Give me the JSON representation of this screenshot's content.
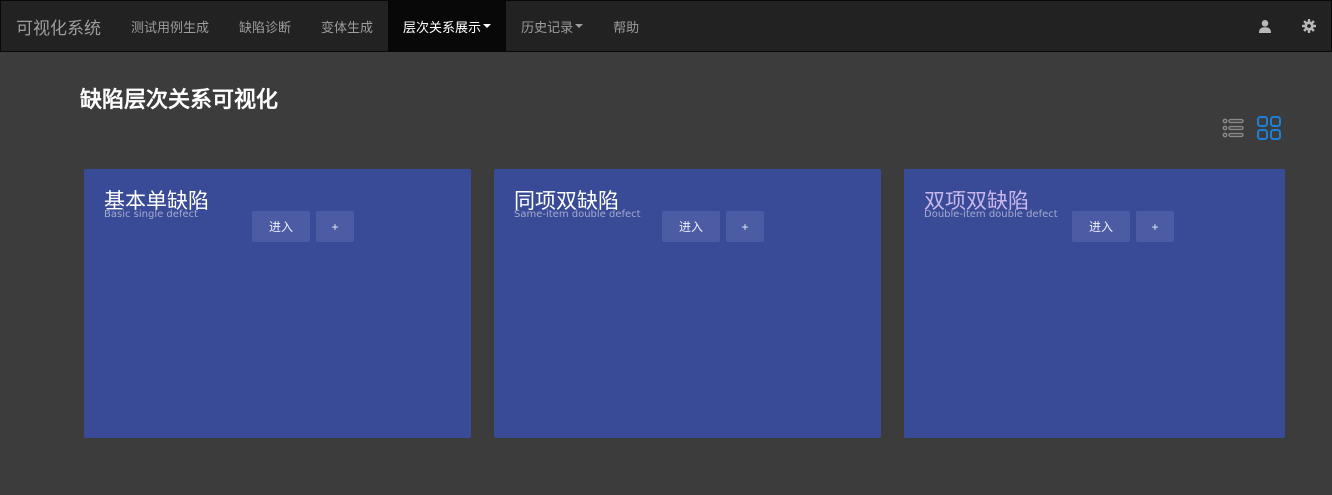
{
  "navbar": {
    "brand": "可视化系统",
    "items": [
      {
        "label": "测试用例生成"
      },
      {
        "label": "缺陷诊断"
      },
      {
        "label": "变体生成"
      },
      {
        "label": "层次关系展示",
        "active": true,
        "dropdown": true
      },
      {
        "label": "历史记录",
        "dropdown": true
      },
      {
        "label": "帮助"
      }
    ],
    "right_icons": [
      "user-icon",
      "gear-icon"
    ]
  },
  "page": {
    "title": "缺陷层次关系可视化",
    "view_toggle": {
      "list_icon": "list-icon",
      "grid_icon": "grid-icon",
      "selected": "grid",
      "accent": "#1e7fd8"
    }
  },
  "cards": [
    {
      "title": "基本单缺陷",
      "subtitle": "Basic single defect",
      "enter_label": "进入",
      "add_label": "+"
    },
    {
      "title": "同项双缺陷",
      "subtitle": "Same-item double defect",
      "enter_label": "进入",
      "add_label": "+"
    },
    {
      "title": "双项双缺陷",
      "subtitle": "Double-item double defect",
      "enter_label": "进入",
      "add_label": "+"
    }
  ],
  "colors": {
    "card_bg": "#394b96",
    "navbar_bg": "#222222",
    "page_bg": "#3c3c3c"
  }
}
